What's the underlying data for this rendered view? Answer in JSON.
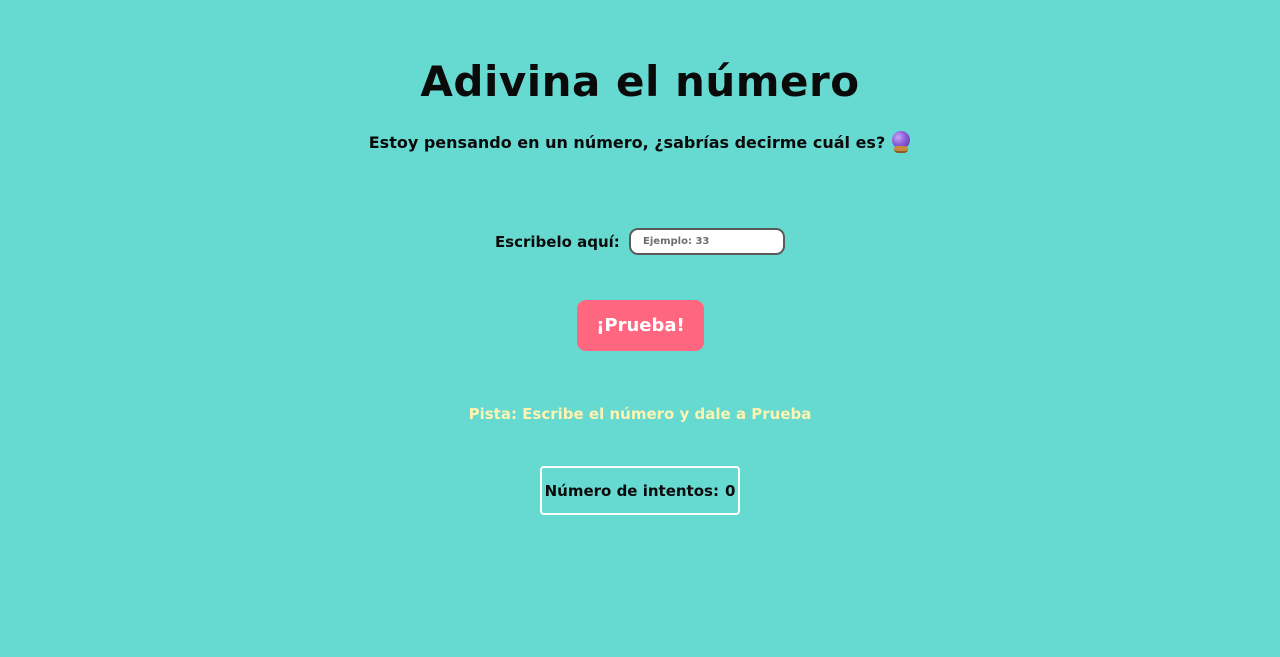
{
  "header": {
    "title": "Adivina el número",
    "subtitle": "Estoy pensando en un número, ¿sabrías decirme cuál es?",
    "subtitle_icon": "crystal-ball-icon"
  },
  "form": {
    "label": "Escribelo aquí:",
    "input_value": "",
    "input_placeholder": "Ejemplo: 33",
    "button_label": "¡Prueba!"
  },
  "hint": {
    "text": "Pista: Escribe el número y dale a Prueba"
  },
  "attempts": {
    "label": "Número de intentos:",
    "count": "0"
  },
  "colors": {
    "background": "#66d9d1",
    "button": "#ff6680",
    "hint_text": "#fff3b0",
    "attempts_border": "#ffffff"
  }
}
